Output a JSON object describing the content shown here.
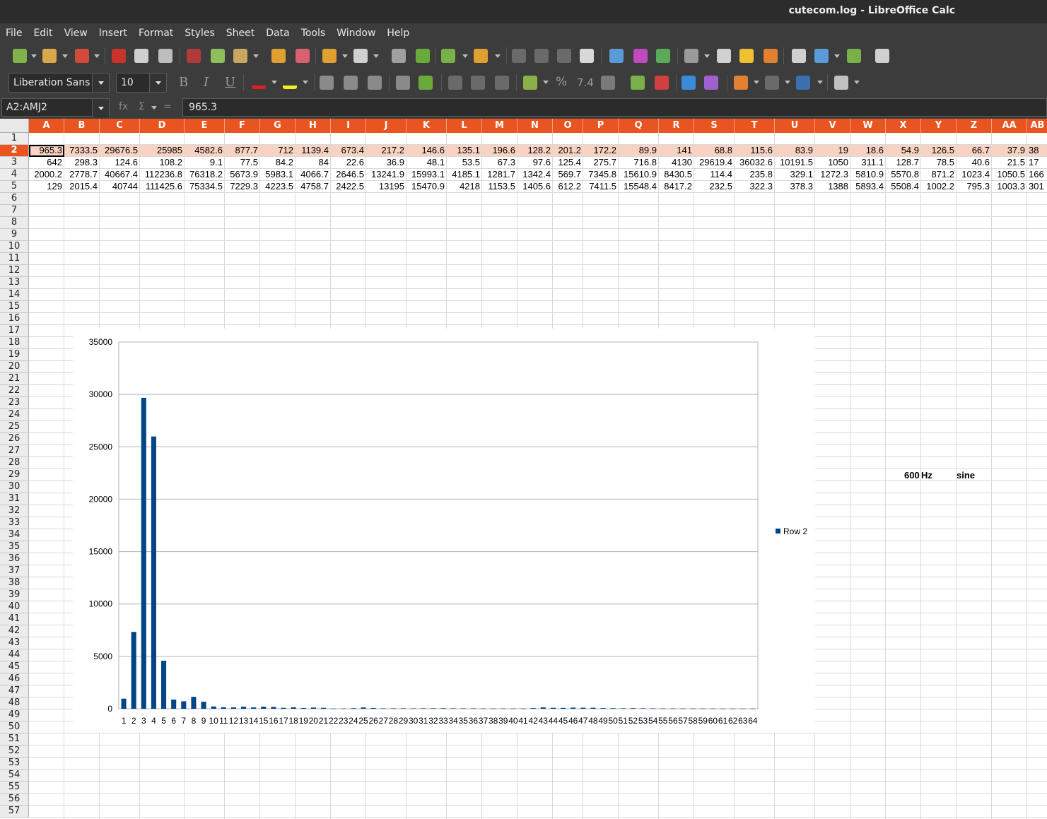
{
  "window": {
    "title": "cutecom.log - LibreOffice Calc"
  },
  "menu": [
    "File",
    "Edit",
    "View",
    "Insert",
    "Format",
    "Styles",
    "Sheet",
    "Data",
    "Tools",
    "Window",
    "Help"
  ],
  "format_toolbar": {
    "font_name": "Liberation Sans",
    "font_size": "10",
    "bold": "B",
    "italic": "I",
    "underline": "U",
    "percent": "%",
    "decimal": "7.4"
  },
  "formula_bar": {
    "name_box": "A2:AMJ2",
    "fx": "fx",
    "sigma": "Σ",
    "equals": "=",
    "content": "965.3"
  },
  "columns": [
    "A",
    "B",
    "C",
    "D",
    "E",
    "F",
    "G",
    "H",
    "I",
    "J",
    "K",
    "L",
    "M",
    "N",
    "O",
    "P",
    "Q",
    "R",
    "S",
    "T",
    "U",
    "V",
    "W",
    "X",
    "Y",
    "Z",
    "AA",
    "AB"
  ],
  "rows": [
    [],
    [
      "965.3",
      "7333.5",
      "29676.5",
      "25985",
      "4582.6",
      "877.7",
      "712",
      "1139.4",
      "673.4",
      "217.2",
      "146.6",
      "135.1",
      "196.6",
      "128.2",
      "201.2",
      "172.2",
      "89.9",
      "141",
      "68.8",
      "115.6",
      "83.9",
      "19",
      "18.6",
      "54.9",
      "126.5",
      "66.7",
      "37.9",
      "38"
    ],
    [
      "642",
      "298.3",
      "124.6",
      "108.2",
      "9.1",
      "77.5",
      "84.2",
      "84",
      "22.6",
      "36.9",
      "48.1",
      "53.5",
      "67.3",
      "97.6",
      "125.4",
      "275.7",
      "716.8",
      "4130",
      "29619.4",
      "36032.6",
      "10191.5",
      "1050",
      "311.1",
      "128.7",
      "78.5",
      "40.6",
      "21.5",
      "17"
    ],
    [
      "2000.2",
      "2778.7",
      "40667.4",
      "112236.8",
      "76318.2",
      "5673.9",
      "5983.1",
      "4066.7",
      "2646.5",
      "13241.9",
      "15993.1",
      "4185.1",
      "1281.7",
      "1342.4",
      "569.7",
      "7345.8",
      "15610.9",
      "8430.5",
      "114.4",
      "235.8",
      "329.1",
      "1272.3",
      "5810.9",
      "5570.8",
      "871.2",
      "1023.4",
      "1050.5",
      "166"
    ],
    [
      "129",
      "2015.4",
      "40744",
      "111425.6",
      "75334.5",
      "7229.3",
      "4223.5",
      "4758.7",
      "2422.5",
      "13195",
      "15470.9",
      "4218",
      "1153.5",
      "1405.6",
      "612.2",
      "7411.5",
      "15548.4",
      "8417.2",
      "232.5",
      "322.3",
      "378.3",
      "1388",
      "5893.4",
      "5508.4",
      "1002.2",
      "795.3",
      "1003.3",
      "301"
    ]
  ],
  "notes": {
    "freq_value": "600",
    "freq_unit": "Hz",
    "wave": "sine"
  },
  "chart_data": {
    "type": "bar",
    "series": [
      {
        "name": "Row 2",
        "values": [
          965.3,
          7333.5,
          29676.5,
          25985,
          4582.6,
          877.7,
          712,
          1139.4,
          673.4,
          217.2,
          146.6,
          135.1,
          196.6,
          128.2,
          201.2,
          172.2,
          89.9,
          141,
          68.8,
          115.6,
          83.9,
          19,
          18.6,
          54.9,
          126.5,
          66.7,
          37.9,
          38,
          40,
          35,
          42,
          45,
          48,
          40,
          38,
          36,
          30,
          28,
          25,
          22,
          22,
          60,
          130,
          90,
          80,
          110,
          100,
          95,
          60,
          50,
          45,
          55,
          40,
          35,
          30,
          28,
          25,
          22,
          20,
          18,
          18,
          15,
          15,
          12
        ]
      }
    ],
    "categories": [
      "1",
      "2",
      "3",
      "4",
      "5",
      "6",
      "7",
      "8",
      "9",
      "10",
      "11",
      "12",
      "13",
      "14",
      "15",
      "16",
      "17",
      "18",
      "19",
      "20",
      "21",
      "22",
      "23",
      "24",
      "25",
      "26",
      "27",
      "28",
      "29",
      "30",
      "31",
      "32",
      "33",
      "34",
      "35",
      "36",
      "37",
      "38",
      "39",
      "40",
      "41",
      "42",
      "43",
      "44",
      "45",
      "46",
      "47",
      "48",
      "49",
      "50",
      "51",
      "52",
      "53",
      "54",
      "55",
      "56",
      "57",
      "58",
      "59",
      "60",
      "61",
      "62",
      "63",
      "64"
    ],
    "ylim": [
      0,
      35000
    ],
    "yticks": [
      "0",
      "5000",
      "10000",
      "15000",
      "20000",
      "25000",
      "30000",
      "35000"
    ],
    "grid": true,
    "legend": "right",
    "color": "#004586"
  }
}
